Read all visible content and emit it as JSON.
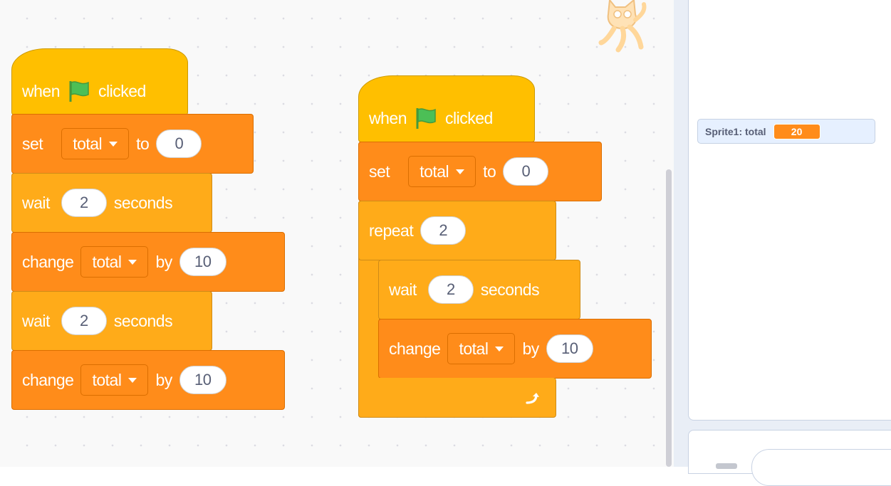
{
  "script_left": {
    "hat": {
      "when": "when",
      "clicked": "clicked"
    },
    "set": {
      "label": "set",
      "var": "total",
      "to": "to",
      "value": "0"
    },
    "wait1": {
      "label": "wait",
      "value": "2",
      "unit": "seconds"
    },
    "change1": {
      "label": "change",
      "var": "total",
      "by": "by",
      "value": "10"
    },
    "wait2": {
      "label": "wait",
      "value": "2",
      "unit": "seconds"
    },
    "change2": {
      "label": "change",
      "var": "total",
      "by": "by",
      "value": "10"
    }
  },
  "script_right": {
    "hat": {
      "when": "when",
      "clicked": "clicked"
    },
    "set": {
      "label": "set",
      "var": "total",
      "to": "to",
      "value": "0"
    },
    "repeat": {
      "label": "repeat",
      "value": "2"
    },
    "wait": {
      "label": "wait",
      "value": "2",
      "unit": "seconds"
    },
    "change": {
      "label": "change",
      "var": "total",
      "by": "by",
      "value": "10"
    }
  },
  "monitor": {
    "label": "Sprite1: total",
    "value": "20"
  },
  "colors": {
    "events": "#ffbf00",
    "variables": "#ff8c1a",
    "control": "#ffab19",
    "flag": "#4cbf56"
  },
  "icons": [
    "green-flag-icon",
    "dropdown-caret-icon",
    "repeat-arrow-icon",
    "scratch-cat-icon"
  ]
}
